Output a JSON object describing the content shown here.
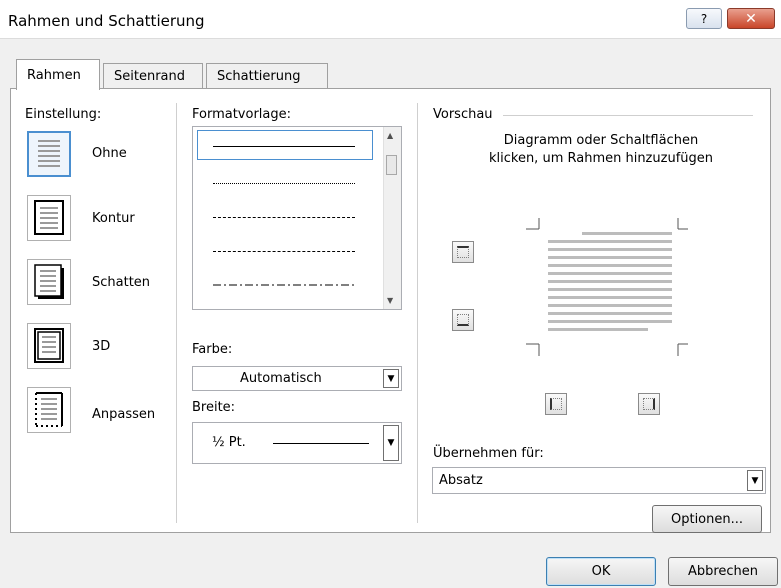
{
  "window": {
    "title": "Rahmen und Schattierung",
    "help_label": "?",
    "close_label": "✕"
  },
  "tabs": [
    {
      "label": "Rahmen"
    },
    {
      "label": "Seitenrand"
    },
    {
      "label": "Schattierung"
    }
  ],
  "settings": {
    "label": "Einstellung:",
    "items": [
      {
        "label": "Ohne",
        "icon": "setting-none-icon"
      },
      {
        "label": "Kontur",
        "icon": "setting-box-icon"
      },
      {
        "label": "Schatten",
        "icon": "setting-shadow-icon"
      },
      {
        "label": "3D",
        "icon": "setting-3d-icon"
      },
      {
        "label": "Anpassen",
        "icon": "setting-custom-icon"
      }
    ]
  },
  "style": {
    "label": "Formatvorlage:"
  },
  "color": {
    "label": "Farbe:",
    "value": "Automatisch"
  },
  "width": {
    "label": "Breite:",
    "value": "½ Pt."
  },
  "preview": {
    "label": "Vorschau",
    "instruction": "Diagramm oder Schaltflächen klicken, um Rahmen hinzuzufügen"
  },
  "apply_to": {
    "label": "Übernehmen für:",
    "value": "Absatz"
  },
  "buttons": {
    "options": "Optionen...",
    "ok": "OK",
    "cancel": "Abbrechen"
  }
}
